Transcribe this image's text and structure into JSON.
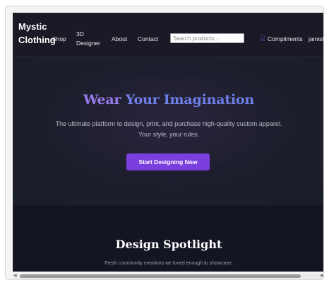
{
  "header": {
    "logo": "Mystic Clothing",
    "nav": {
      "shop": "Shop",
      "designer": "3D Designer",
      "about": "About",
      "contact": "Contact",
      "compliments": "Compliments",
      "user": "jainish"
    },
    "search": {
      "placeholder": "Search products...",
      "value": ""
    },
    "compliments_icon": "user-icon"
  },
  "hero": {
    "title_part1": "Wear ",
    "title_part2": "Your Imagination",
    "subtitle": "The ultimate platform to design, print, and purchase high-quality custom apparel. Your style, your rules.",
    "cta_label": "Start Designing Now"
  },
  "spotlight": {
    "title": "Design Spotlight",
    "subtitle": "Fresh community creations we loved enough to showcase."
  },
  "colors": {
    "accent": "#7b3fe0",
    "title_gradient_start": "#9a7cf0",
    "title_gradient_end": "#6e7fe8",
    "background": "#151520"
  }
}
